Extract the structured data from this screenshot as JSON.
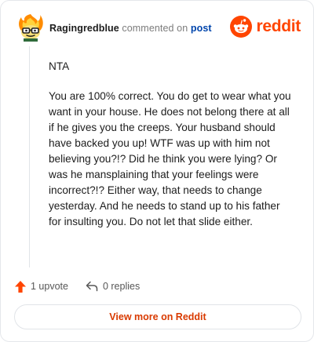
{
  "header": {
    "username": "Ragingredblue",
    "action_text": "commented on",
    "post_link": "post",
    "brand_name": "reddit"
  },
  "comment": {
    "paragraphs": [
      "NTA",
      "You are 100% correct. You do get to wear what you want in your house. He does not belong there at all if he gives you the creeps. Your husband should have backed you up! WTF was up with him not believing you?!? Did he think you were lying? Or was he mansplaining that your feelings were incorrect?!? Either way, that needs to change yesterday. And he needs to stand up to his father for insulting you. Do not let that slide either."
    ]
  },
  "actions": {
    "upvote_label": "1 upvote",
    "replies_label": "0 replies"
  },
  "footer": {
    "view_more_label": "View more on Reddit"
  },
  "colors": {
    "brand": "#ff4500",
    "link": "#0045ac",
    "view_more": "#d93a00"
  },
  "icons": {
    "avatar": "flame-avatar-icon",
    "logo": "reddit-snoo-icon",
    "upvote": "upvote-arrow-icon",
    "reply": "reply-arrow-icon"
  }
}
